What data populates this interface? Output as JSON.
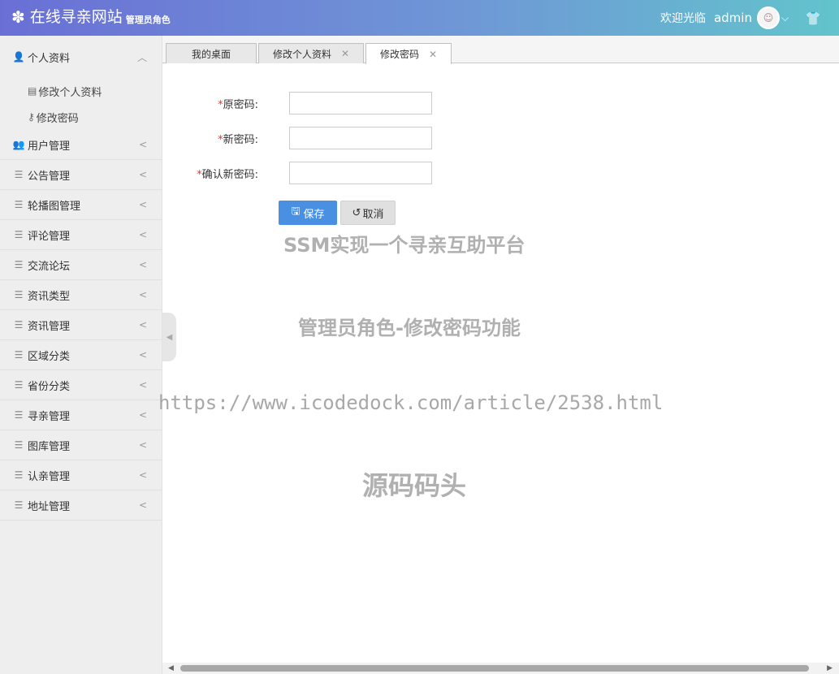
{
  "header": {
    "title": "在线寻亲网站",
    "role": "管理员角色",
    "welcome": "欢迎光临",
    "username": "admin"
  },
  "sidebar": {
    "profile": {
      "label": "个人资料",
      "subitems": [
        {
          "label": "修改个人资料"
        },
        {
          "label": "修改密码"
        }
      ]
    },
    "items": [
      {
        "label": "用户管理"
      },
      {
        "label": "公告管理"
      },
      {
        "label": "轮播图管理"
      },
      {
        "label": "评论管理"
      },
      {
        "label": "交流论坛"
      },
      {
        "label": "资讯类型"
      },
      {
        "label": "资讯管理"
      },
      {
        "label": "区域分类"
      },
      {
        "label": "省份分类"
      },
      {
        "label": "寻亲管理"
      },
      {
        "label": "图库管理"
      },
      {
        "label": "认亲管理"
      },
      {
        "label": "地址管理"
      }
    ]
  },
  "tabs": [
    {
      "label": "我的桌面"
    },
    {
      "label": "修改个人资料"
    },
    {
      "label": "修改密码"
    }
  ],
  "form": {
    "old_password_label": "原密码:",
    "new_password_label": "新密码:",
    "confirm_password_label": "确认新密码:",
    "required_mark": "*",
    "old_password_value": "",
    "new_password_value": "",
    "confirm_password_value": "",
    "save_label": "保存",
    "cancel_label": "取消"
  },
  "watermark": {
    "line1": "SSM实现一个寻亲互助平台",
    "line2": "管理员角色-修改密码功能",
    "line3": "https://www.icodedock.com/article/2538.html",
    "line4": "源码码头"
  }
}
